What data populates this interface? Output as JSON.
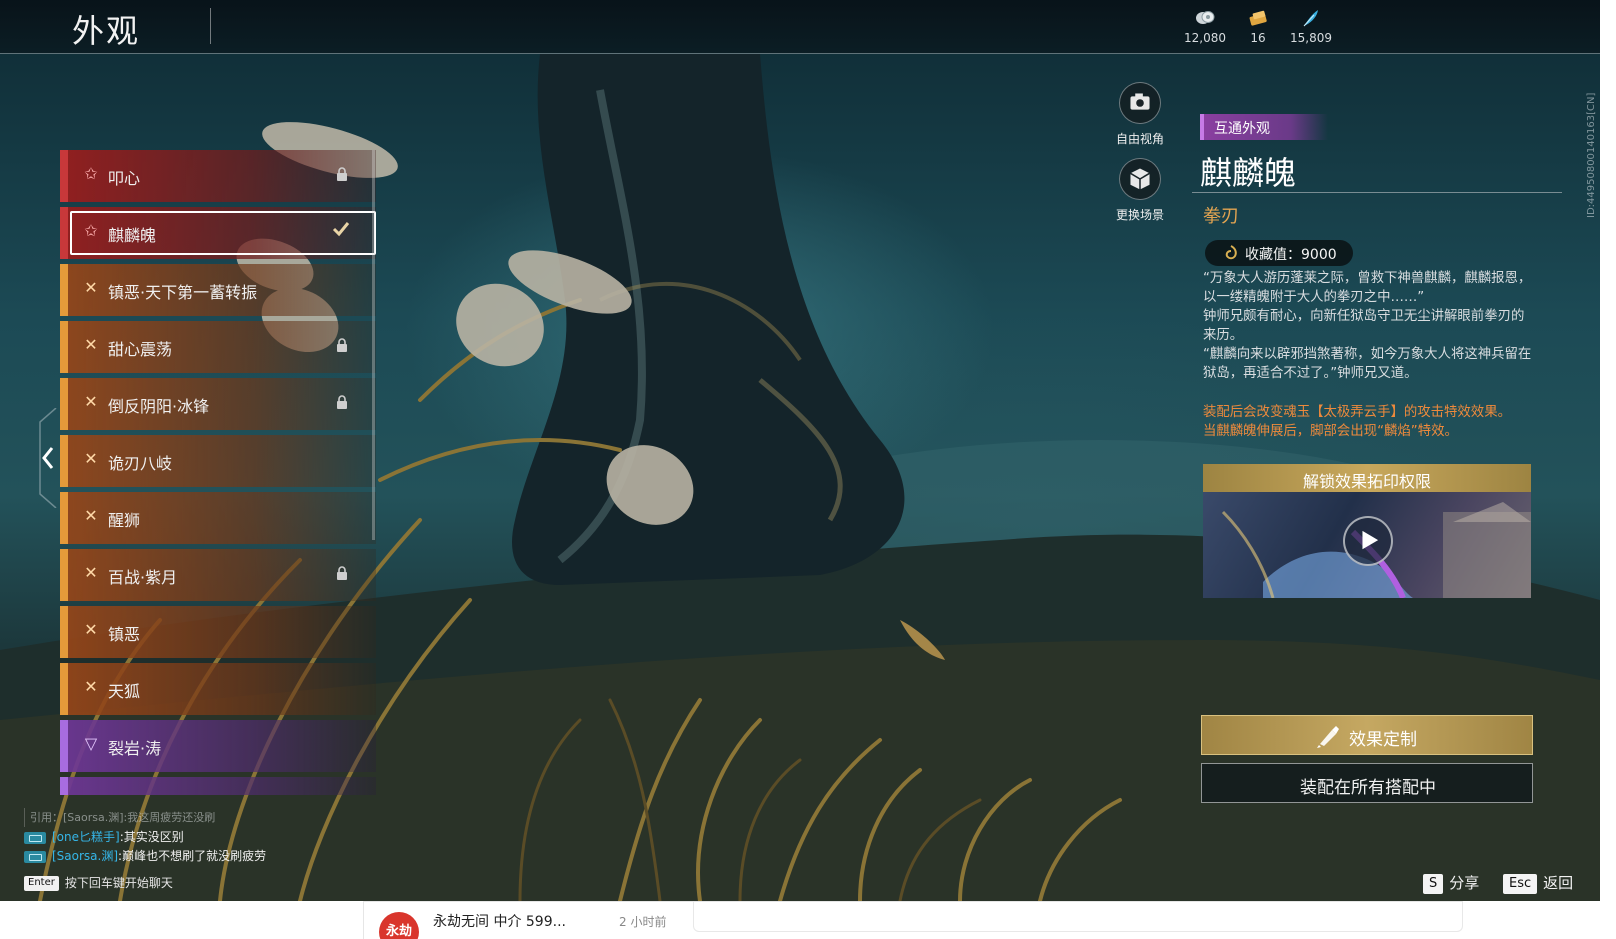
{
  "header": {
    "title": "外观",
    "currencies": [
      {
        "icon": "coin-stack-icon",
        "value": "12,080"
      },
      {
        "icon": "ticket-icon",
        "value": "16"
      },
      {
        "icon": "feather-icon",
        "value": "15,809"
      }
    ]
  },
  "side_id": "ID:44950800140163[CN]",
  "list": {
    "items": [
      {
        "label": "叩心",
        "rarity": "red",
        "locked": true,
        "selected": false
      },
      {
        "label": "麒麟魄",
        "rarity": "red",
        "locked": false,
        "selected": true
      },
      {
        "label": "镇恶·天下第一蓄转振",
        "rarity": "orange",
        "locked": false,
        "selected": false
      },
      {
        "label": "甜心震荡",
        "rarity": "orange",
        "locked": true,
        "selected": false
      },
      {
        "label": "倒反阴阳·冰锋",
        "rarity": "orange",
        "locked": true,
        "selected": false
      },
      {
        "label": "诡刃八岐",
        "rarity": "orange",
        "locked": false,
        "selected": false
      },
      {
        "label": "醒狮",
        "rarity": "orange",
        "locked": false,
        "selected": false
      },
      {
        "label": "百战·紫月",
        "rarity": "orange",
        "locked": true,
        "selected": false
      },
      {
        "label": "镇恶",
        "rarity": "orange",
        "locked": false,
        "selected": false
      },
      {
        "label": "天狐",
        "rarity": "orange",
        "locked": false,
        "selected": false
      },
      {
        "label": "裂岩·涛",
        "rarity": "purple",
        "locked": false,
        "selected": false
      }
    ]
  },
  "view_controls": {
    "free_camera": "自由视角",
    "change_scene": "更换场景"
  },
  "detail": {
    "tag": "互通外观",
    "name": "麒麟魄",
    "type": "拳刃",
    "collect_value": "收藏值：9000",
    "description": [
      "“万象大人游历蓬莱之际，曾救下神兽麒麟，麒麟报恩，以一缕精魄附于大人的拳刃之中……”",
      "钟师兄颇有耐心，向新任狱岛守卫无尘讲解眼前拳刃的来历。",
      "“麒麟向来以辟邪挡煞著称，如今万象大人将这神兵留在狱岛，再适合不过了。”钟师兄又道。"
    ],
    "effects": [
      "装配后会改变魂玉【太极弄云手】的攻击特效效果。",
      "当麒麟魄伸展后，脚部会出现“麟焰”特效。"
    ],
    "unlock_title": "解锁效果拓印权限",
    "custom_button": "效果定制",
    "equip_button": "装配在所有搭配中"
  },
  "chat": {
    "quote": "引用：[Saorsa.渊]:我这周疲劳还没刷",
    "messages": [
      {
        "name": "[one匕糕手]",
        "text": ":其实没区别"
      },
      {
        "name": "[Saorsa.渊]",
        "text": ":巅峰也不想刷了就没刷疲劳"
      }
    ],
    "enter_key": "Enter",
    "enter_hint": "按下回车键开始聊天"
  },
  "hints": [
    {
      "key": "S",
      "label": "分享"
    },
    {
      "key": "Esc",
      "label": "返回"
    }
  ],
  "notification": {
    "avatar_text": "永劫",
    "title": "永劫无间 中介 599...",
    "time": "2 小时前"
  }
}
